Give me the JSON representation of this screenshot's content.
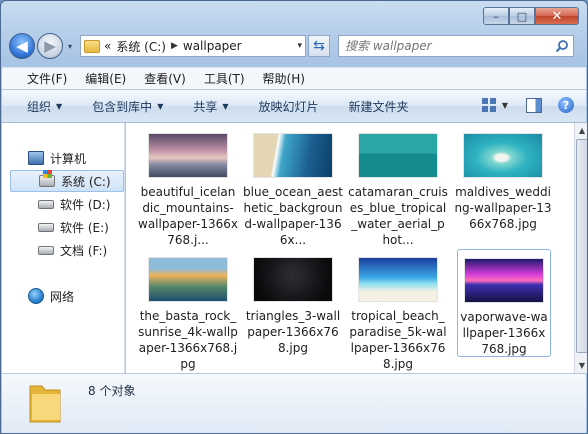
{
  "window": {
    "min_label": "–",
    "max_label": "□",
    "close_label": "✕"
  },
  "nav": {
    "back_glyph": "◀",
    "forward_glyph": "▶",
    "drop_glyph": "▾",
    "address": {
      "overflow": "«",
      "crumbs": [
        "系统 (C:)",
        "wallpaper"
      ],
      "separator": "▶",
      "drop": "▾"
    },
    "refresh_glyph": "⇆",
    "search": {
      "placeholder": "搜索 wallpaper"
    }
  },
  "menubar": [
    "文件(F)",
    "编辑(E)",
    "查看(V)",
    "工具(T)",
    "帮助(H)"
  ],
  "toolbar": {
    "items": [
      {
        "label": "组织",
        "has_dropdown": true
      },
      {
        "label": "包含到库中",
        "has_dropdown": true
      },
      {
        "label": "共享",
        "has_dropdown": true
      },
      {
        "label": "放映幻灯片",
        "has_dropdown": false
      },
      {
        "label": "新建文件夹",
        "has_dropdown": false
      }
    ],
    "dropdown_glyph": "▼",
    "help_glyph": "?"
  },
  "sidebar": {
    "computer": "计算机",
    "drives": [
      {
        "label": "系统 (C:)",
        "selected": true
      },
      {
        "label": "软件 (D:)",
        "selected": false
      },
      {
        "label": "软件 (E:)",
        "selected": false
      },
      {
        "label": "文档 (F:)",
        "selected": false
      }
    ],
    "network": "网络"
  },
  "files": [
    {
      "name": "beautiful_icelandic_mountains-wallpaper-1366x768.j...",
      "thumb": "t-ice",
      "selected": false
    },
    {
      "name": "blue_ocean_aesthetic_background-wallpaper-1366x...",
      "thumb": "t-ocean",
      "selected": false
    },
    {
      "name": "catamaran_cruises_blue_tropical_water_aerial_phot...",
      "thumb": "t-catamaran",
      "selected": false
    },
    {
      "name": "maldives_wedding-wallpaper-1366x768.jpg",
      "thumb": "t-maldives",
      "selected": false
    },
    {
      "name": "the_basta_rock_sunrise_4k-wallpaper-1366x768.jpg",
      "thumb": "t-rock",
      "selected": false
    },
    {
      "name": "triangles_3-wallpaper-1366x768.jpg",
      "thumb": "t-triangles",
      "selected": false
    },
    {
      "name": "tropical_beach_paradise_5k-wallpaper-1366x768.jpg",
      "thumb": "t-tropical",
      "selected": false
    },
    {
      "name": "vaporwave-wallpaper-1366x768.jpg",
      "thumb": "t-vapor",
      "selected": true
    }
  ],
  "status": {
    "count_text": "8 个对象"
  },
  "scrollbar": {
    "up": "▲",
    "down": "▼"
  }
}
